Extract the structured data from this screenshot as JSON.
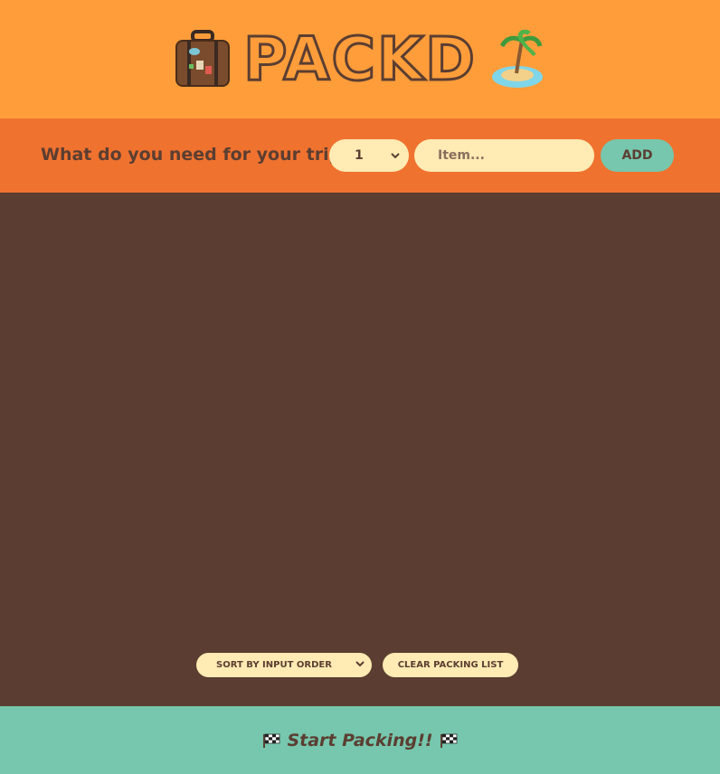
{
  "header": {
    "title": "PACKD",
    "left_icon": "suitcase-icon",
    "right_icon": "desert-island-icon"
  },
  "form": {
    "prompt": "What do you need for your trip?",
    "quantity_value": "1",
    "item_placeholder": "Item...",
    "add_label": "ADD"
  },
  "actions": {
    "sort_value": "SORT BY INPUT ORDER",
    "clear_label": "CLEAR PACKING LIST"
  },
  "stats": {
    "message": "Start Packing!!",
    "icon": "checkered-flag-icon"
  },
  "colors": {
    "header_bg": "#ff9d3a",
    "form_bg": "#f0722f",
    "list_bg": "#5b3e31",
    "stats_bg": "#76c7ad",
    "input_bg": "#ffebb3",
    "text": "#5b3e31"
  }
}
